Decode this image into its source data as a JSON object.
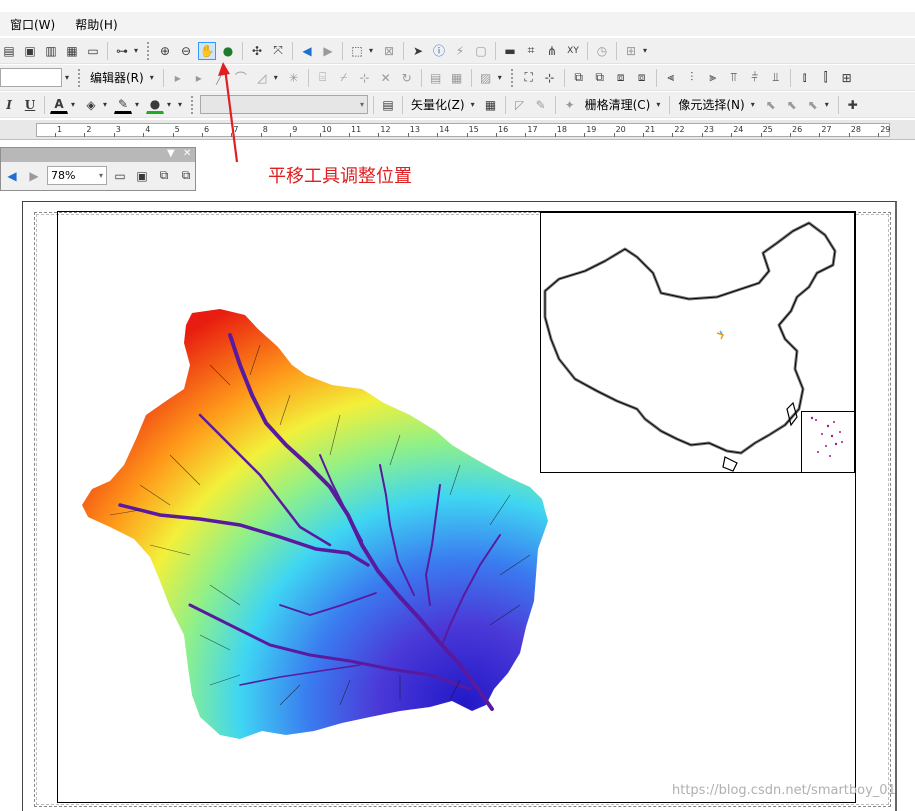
{
  "menu": [
    "窗口(W)",
    "帮助(H)"
  ],
  "toolbar2": {
    "editor_label": "编辑器(R)"
  },
  "toolbar3": {
    "vectorize_label": "矢量化(Z)",
    "raster_cleanup_label": "栅格清理(C)",
    "cell_select_label": "像元选择(N)"
  },
  "ruler": {
    "labels": [
      "1",
      "2",
      "3",
      "4",
      "5",
      "6",
      "7",
      "8",
      "9",
      "10",
      "11",
      "12",
      "13",
      "14",
      "15",
      "16",
      "17",
      "18",
      "19",
      "20",
      "21",
      "22",
      "23",
      "24",
      "25",
      "26",
      "27",
      "28",
      "29"
    ]
  },
  "zoom": {
    "value": "78%"
  },
  "annotation": {
    "text": "平移工具调整位置"
  },
  "watermark": {
    "text": "https://blog.csdn.net/smartboy_01"
  },
  "colors": {
    "accent": "#e02020",
    "active_tool": "#cfe6ff"
  },
  "icons": {
    "pan_tool": "hand-icon",
    "zoom_in": "magnifier-plus-icon",
    "zoom_out": "magnifier-minus-icon",
    "globe": "globe-icon",
    "identify": "info-icon",
    "select": "arrow-pointer-icon"
  }
}
